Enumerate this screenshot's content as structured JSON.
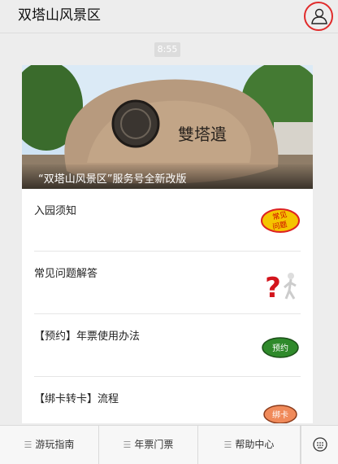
{
  "header": {
    "title": "双塔山风景区",
    "profile_icon": "user-icon"
  },
  "chat": {
    "time": "8:55"
  },
  "article": {
    "banner_caption": "“双塔山风景区”服务号全新改版",
    "banner_sign_text": "雙塔遺",
    "items": [
      {
        "label": "入园须知",
        "thumb_text": "常见\n问题"
      },
      {
        "label": "常见问题解答",
        "thumb_text": "?"
      },
      {
        "label": "【预约】年票使用办法",
        "thumb_text": "预约"
      },
      {
        "label": "【绑卡转卡】流程",
        "thumb_text": "绑卡"
      }
    ]
  },
  "bottom_menu": {
    "keyboard_icon": "keyboard-icon",
    "tabs": [
      {
        "label": "游玩指南"
      },
      {
        "label": "年票门票"
      },
      {
        "label": "帮助中心"
      }
    ]
  },
  "colors": {
    "accent_red": "#e02b2b",
    "background": "#ededed"
  }
}
